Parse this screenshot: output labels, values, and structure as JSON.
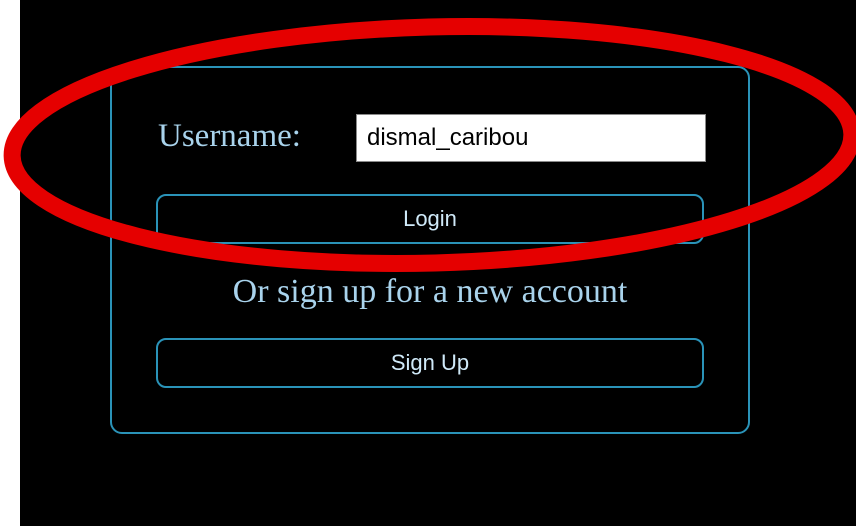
{
  "login_form": {
    "username_label": "Username:",
    "username_value": "dismal_caribou",
    "login_label": "Login",
    "signup_prompt": "Or sign up for a new account",
    "signup_label": "Sign Up"
  },
  "colors": {
    "background": "#000000",
    "accent_border": "#2a93b8",
    "label_text": "#a9d3ec",
    "annotation": "#e50000"
  }
}
